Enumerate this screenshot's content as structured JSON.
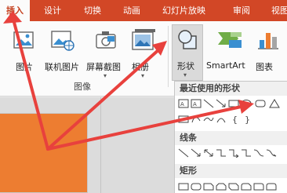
{
  "tabs": [
    {
      "label": "插入",
      "active": true
    },
    {
      "label": "设计"
    },
    {
      "label": "切换"
    },
    {
      "label": "动画"
    },
    {
      "label": "幻灯片放映"
    },
    {
      "label": "审阅"
    },
    {
      "label": "视图"
    }
  ],
  "ribbon": {
    "buttons": {
      "picture": "图片",
      "online_picture": "联机图片",
      "screenshot": "屏幕截图",
      "album": "相册",
      "shapes": "形状",
      "smartart": "SmartArt",
      "chart": "图表"
    },
    "group_label": "图像"
  },
  "dropdown": {
    "recent_header": "最近使用的形状",
    "lines_header": "线条",
    "rect_header": "矩形"
  },
  "colors": {
    "tab_bar": "#d24726",
    "active_tab_text": "#c43e1c",
    "slide_thumb": "#ed7d31",
    "arrow": "#e8413d"
  }
}
